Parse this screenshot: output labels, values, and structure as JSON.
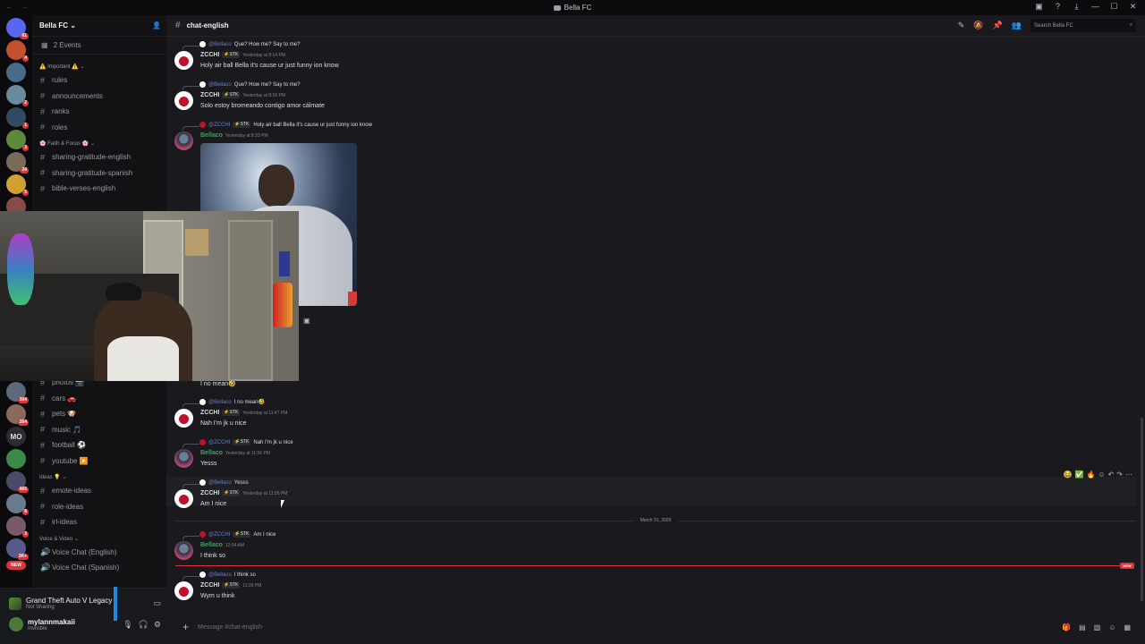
{
  "titlebar": {
    "title": "Bella FC"
  },
  "server": {
    "name": "Bella FC",
    "events": "2 Events",
    "categories": [
      {
        "label": "⚠️ Important ⚠️",
        "channels": [
          "rules",
          "announcements",
          "ranks",
          "roles"
        ]
      },
      {
        "label": "🌸 Faith & Focus 🌸",
        "channels": [
          "sharing-gratitude-english",
          "sharing-gratitude-spanish",
          "bible-verses-english"
        ]
      }
    ],
    "lower_channels": [
      "photos 📷",
      "cars 🚗",
      "pets 🐶",
      "music 🎵",
      "football ⚽",
      "youtube ▶️"
    ],
    "ideas_label": "Ideas 💡",
    "ideas_channels": [
      "emote-ideas",
      "role-ideas",
      "irl-ideas"
    ],
    "voice_label": "Voice & Video",
    "voice_channels": [
      "Voice Chat (English)",
      "Voice Chat (Spanish)"
    ]
  },
  "server_badges": [
    "61",
    "4",
    "2",
    "1",
    "3",
    "24",
    "5",
    "6",
    "4",
    "304",
    "5",
    "264",
    "MO",
    "465",
    "8",
    "3",
    "3K+",
    "NEW"
  ],
  "activity": {
    "title": "Grand Theft Auto V Legacy",
    "status": "Not Sharing"
  },
  "user": {
    "name": "mylannmakaii",
    "status": "Invisible"
  },
  "channel": {
    "name": "chat-english",
    "search_placeholder": "Search Bella FC",
    "composer_placeholder": "Message #chat-english"
  },
  "messages": [
    {
      "reply_user": "@Bellaco",
      "reply_text": "Que? How me? Say to me?",
      "author": "ZCCHI",
      "tag": "⚡STK",
      "time": "Yesterday at 8:14 PM",
      "text": "Holy air ball Bella it's cause ur just funny ion know"
    },
    {
      "reply_user": "@Bellaco",
      "reply_text": "Que? How me? Say to me?",
      "author": "ZCCHI",
      "tag": "⚡STK",
      "time": "Yesterday at 8:16 PM",
      "text": "Solo estoy bromeando contigo amor cálmate"
    },
    {
      "reply_user": "@ZCCHI",
      "reply_tag": "⚡STK",
      "reply_text": "Holy air ball Bella it's cause ur just funny ion know",
      "author": "Bellaco",
      "time": "Yesterday at 8:33 PM",
      "text": ""
    },
    {
      "text": "I no mean🤣"
    },
    {
      "reply_user": "@Bellaco",
      "reply_text": "I no mean🤣",
      "author": "ZCCHI",
      "tag": "⚡STK",
      "time": "Yesterday at 11:47 PM",
      "text": "Nah I'm jk u nice"
    },
    {
      "reply_user": "@ZCCHI",
      "reply_tag": "⚡STK",
      "reply_text": "Nah I'm jk u nice",
      "author": "Bellaco",
      "time": "Yesterday at 11:56 PM",
      "text": "Yesss"
    },
    {
      "reply_user": "@Bellaco",
      "reply_text": "Yesss",
      "author": "ZCCHI",
      "tag": "⚡STK",
      "time": "Yesterday at 11:56 PM",
      "text": "Am I nice"
    },
    {
      "reply_user": "@ZCCHI",
      "reply_tag": "⚡STK",
      "reply_text": "Am I nice",
      "author": "Bellaco",
      "time": "12:04 AM",
      "text": "I think so"
    },
    {
      "reply_user": "@Bellaco",
      "reply_text": "I think so",
      "author": "ZCCHI",
      "tag": "⚡STK",
      "time": "11:09 PM",
      "text": "Wym u think"
    }
  ],
  "date_divider": "March 31, 2026",
  "new_label": "NEW",
  "colors": {
    "zcchi": "#f2f3f5",
    "bellaco": "#3ba55d",
    "accent": "#e0343b"
  }
}
